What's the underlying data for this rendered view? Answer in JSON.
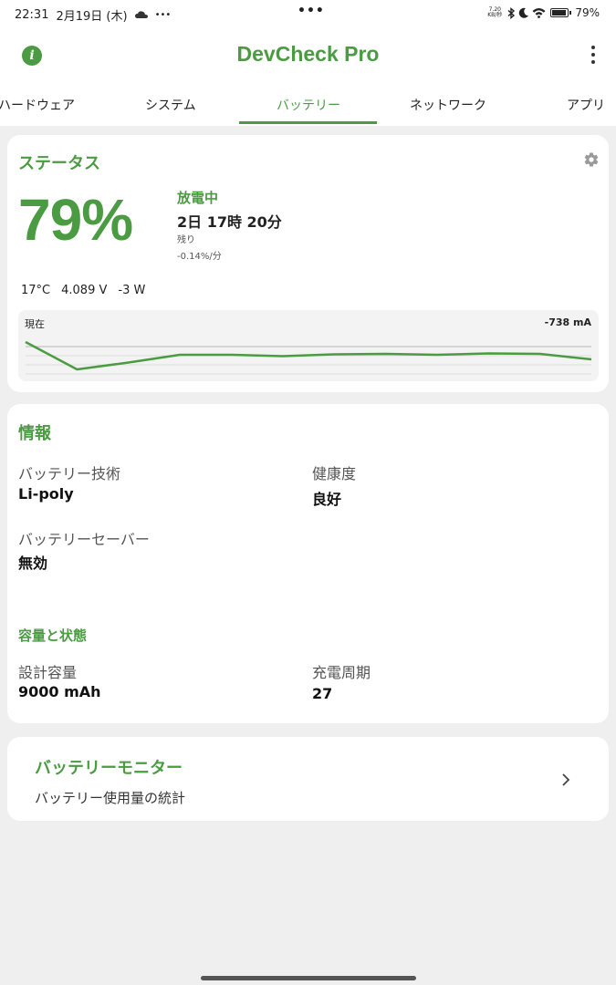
{
  "status_bar": {
    "time": "22:31",
    "date": "2月19日 (木)",
    "more": "•••",
    "speed_value": "7.20",
    "speed_unit": "KB/秒",
    "battery_pct": "79%",
    "battery_level": 0.79
  },
  "app": {
    "title": "DevCheck Pro",
    "info_icon": "i"
  },
  "tabs": [
    {
      "label": "ハードウェア",
      "active": false
    },
    {
      "label": "システム",
      "active": false
    },
    {
      "label": "バッテリー",
      "active": true
    },
    {
      "label": "ネットワーク",
      "active": false
    },
    {
      "label": "アプリ",
      "active": false
    }
  ],
  "status_card": {
    "title": "ステータス",
    "percent": "79%",
    "state": "放電中",
    "remaining": "2日 17時 20分",
    "remaining_label": "残り",
    "rate": "-0.14%/分",
    "temperature": "17°C",
    "voltage": "4.089 V",
    "power": "-3 W",
    "chart_label": "現在",
    "chart_value": "-738 mA",
    "chart_series": [
      -700,
      -760,
      -745,
      -728,
      -728,
      -731,
      -727,
      -726,
      -728,
      -725,
      -726,
      -738
    ]
  },
  "info_card": {
    "title": "情報",
    "technology_label": "バッテリー技術",
    "technology_value": "Li-poly",
    "health_label": "健康度",
    "health_value": "良好",
    "saver_label": "バッテリーセーバー",
    "saver_value": "無効",
    "capacity_section_title": "容量と状態",
    "design_capacity_label": "設計容量",
    "design_capacity_value": "9000 mAh",
    "cycles_label": "充電周期",
    "cycles_value": "27"
  },
  "monitor_card": {
    "title": "バッテリーモニター",
    "subtitle": "バッテリー使用量の統計"
  },
  "colors": {
    "accent": "#4b9b42",
    "background": "#efefef",
    "card": "#ffffff"
  },
  "icons": [
    "info-icon",
    "more-vert-icon",
    "gear-icon",
    "chevron-right-icon",
    "cloud-icon",
    "bluetooth-icon",
    "moon-icon",
    "wifi-icon",
    "battery-icon"
  ]
}
